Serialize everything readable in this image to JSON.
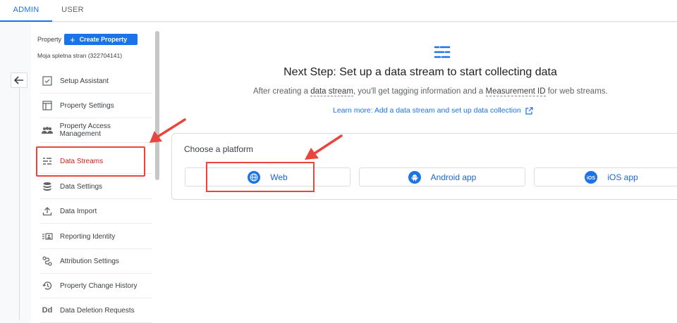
{
  "tabs": [
    {
      "label": "ADMIN",
      "active": true
    },
    {
      "label": "USER",
      "active": false
    }
  ],
  "property": {
    "label": "Property",
    "create_button": "Create Property",
    "name": "Moja spletna stran (322704141)"
  },
  "nav": {
    "items": [
      {
        "label": "Setup Assistant",
        "icon": "checklist-icon"
      },
      {
        "label": "Property Settings",
        "icon": "property-settings-icon"
      },
      {
        "label": "Property Access Management",
        "icon": "people-icon"
      },
      {
        "label": "Data Streams",
        "icon": "data-streams-icon",
        "active": true
      },
      {
        "label": "Data Settings",
        "icon": "database-icon"
      },
      {
        "label": "Data Import",
        "icon": "upload-icon"
      },
      {
        "label": "Reporting Identity",
        "icon": "reporting-identity-icon"
      },
      {
        "label": "Attribution Settings",
        "icon": "attribution-icon"
      },
      {
        "label": "Property Change History",
        "icon": "history-icon"
      },
      {
        "label": "Data Deletion Requests",
        "icon": "data-deletion-icon"
      }
    ]
  },
  "main": {
    "headline": "Next Step: Set up a data stream to start collecting data",
    "sub_before": "After creating a ",
    "sub_link1": "data stream",
    "sub_middle": ", you'll get tagging information and a ",
    "sub_link2": "Measurement ID",
    "sub_after": " for web streams.",
    "learn_more": "Learn more: Add a data stream and set up data collection",
    "platform_title": "Choose a platform",
    "platforms": [
      {
        "label": "Web",
        "icon": "globe-icon"
      },
      {
        "label": "Android app",
        "icon": "android-icon"
      },
      {
        "label": "iOS app",
        "icon": "ios-icon"
      }
    ]
  },
  "colors": {
    "accent": "#1a73e8",
    "highlight": "#e8453c",
    "active_nav": "#c5221f"
  }
}
